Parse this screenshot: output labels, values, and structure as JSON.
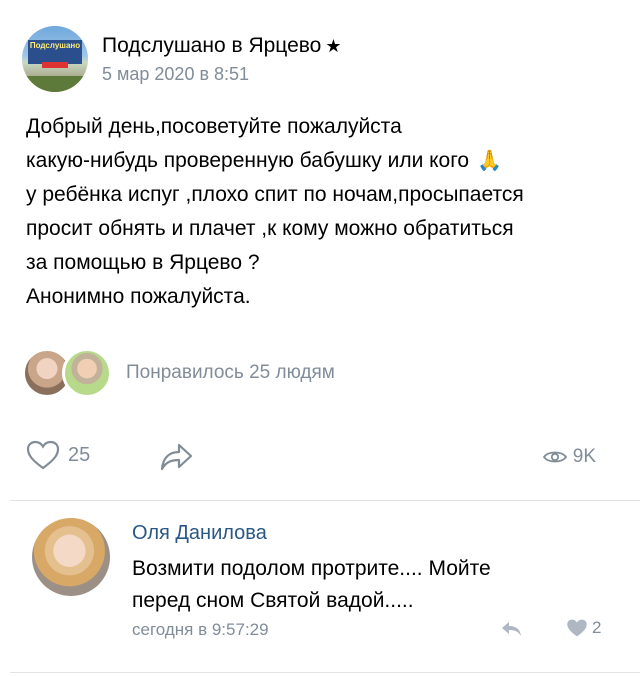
{
  "post": {
    "group_name": "Подслушано в Ярцево",
    "verified_icon": "star-icon",
    "date": "5 мар 2020 в 8:51",
    "avatar_sign_text": "Подслушано",
    "avatar_sign_sub": "ЦЕВ",
    "text_lines": [
      "Добрый день,посоветуйте пожалуйста",
      "какую-нибудь проверенную бабушку или кого",
      "у ребёнка испуг ,плохо спит по ночам,просыпается",
      "просит обнять и плачет ,к кому можно обратиться",
      "за помощью в Ярцево ?",
      "Анонимно пожалуйста."
    ],
    "emoji": "🙏"
  },
  "likers": {
    "text": "Понравилось 25 людям"
  },
  "actions": {
    "like_count": "25",
    "views_count": "9K",
    "like_icon": "heart-icon",
    "share_icon": "share-icon",
    "views_icon": "eye-icon"
  },
  "comment": {
    "author": "Оля Данилова",
    "text_lines": [
      "Возмити подолом протрите.... Мойте",
      "перед сном Святой вадой....."
    ],
    "time": "сегодня в 9:57:29",
    "like_count": "2"
  },
  "colors": {
    "accent_link": "#2a5885",
    "secondary_text": "#818c99",
    "divider": "#e1e3e6"
  }
}
